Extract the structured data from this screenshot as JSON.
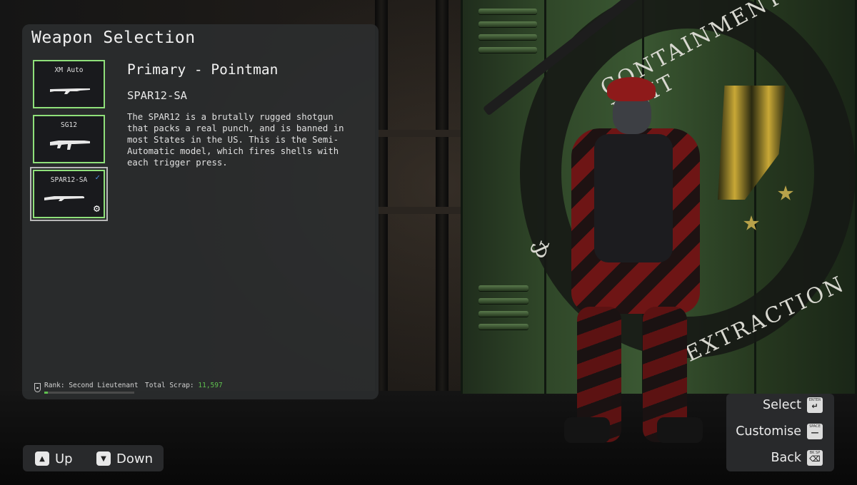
{
  "panel": {
    "title": "Weapon Selection",
    "slots": [
      {
        "label": "XM Auto",
        "selected": false,
        "equipped": false
      },
      {
        "label": "SG12",
        "selected": false,
        "equipped": false
      },
      {
        "label": "SPAR12-SA",
        "selected": true,
        "equipped": true,
        "check_icon": "checkmark-icon",
        "gear_icon": "gear-icon"
      }
    ],
    "detail": {
      "role": "Primary - Pointman",
      "weapon_name": "SPAR12-SA",
      "description": "The SPAR12 is a brutally rugged shotgun\nthat packs a real punch, and is banned in\nmost States in the US.  This is the Semi-\nAutomatic model, which fires shells with\neach trigger press."
    },
    "footer": {
      "rank_label": "Rank: Second Lieutenant",
      "rank_progress": 0.04,
      "scrap_label": "Total Scrap:",
      "scrap_value": "11,597"
    }
  },
  "nav": {
    "up_label": "Up",
    "up_icon": "arrow-up-key-icon",
    "down_label": "Down",
    "down_icon": "arrow-down-key-icon"
  },
  "prompts": [
    {
      "label": "Select",
      "key_caption": "ENTER",
      "icon": "enter-key-icon"
    },
    {
      "label": "Customise",
      "key_caption": "SPACE",
      "icon": "space-key-icon"
    },
    {
      "label": "Back",
      "key_caption": "BK SP",
      "icon": "backspace-key-icon"
    }
  ],
  "emblem": {
    "top_text": "CONTAINMENT UNIT",
    "bottom_text": "EXTRACTION",
    "amp": "&"
  },
  "colors": {
    "slot_border": "#8fe07a",
    "accent_green": "#5fc04f",
    "check_blue": "#4d8fe0",
    "panel_bg": "#2c2e30"
  }
}
